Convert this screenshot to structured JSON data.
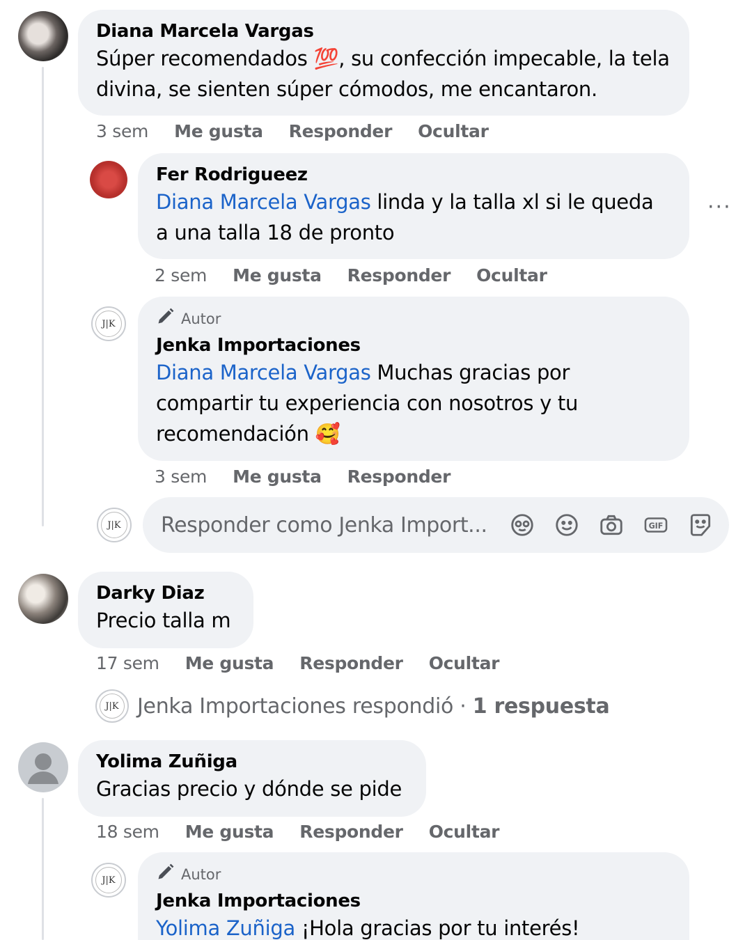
{
  "comments": [
    {
      "author": "Diana Marcela Vargas",
      "text_before": "Súper recomendados ",
      "emoji": "💯",
      "text_after": ", su confección impecable, la tela divina, se sienten súper cómodos, me encantaron.",
      "time": "3 sem",
      "like": "Me gusta",
      "reply": "Responder",
      "hide": "Ocultar"
    },
    {
      "author": "Fer Rodrigueez",
      "mention": "Diana Marcela Vargas",
      "text": " linda y la talla xl si le queda a una talla 18 de pronto",
      "time": "2 sem",
      "like": "Me gusta",
      "reply": "Responder",
      "hide": "Ocultar",
      "more": "···"
    },
    {
      "badge": "Autor",
      "author": "Jenka Importaciones",
      "mention": "Diana Marcela Vargas",
      "text": " Muchas gracias por compartir tu experiencia con nosotros y tu recomendación ",
      "emoji": "🥰",
      "time": "3 sem",
      "like": "Me gusta",
      "reply": "Responder"
    },
    {
      "author": "Darky Diaz",
      "text": "Precio talla m",
      "time": "17 sem",
      "like": "Me gusta",
      "reply": "Responder",
      "hide": "Ocultar"
    },
    {
      "author": "Yolima Zuñiga",
      "text": "Gracias precio y dónde se pide",
      "time": "18 sem",
      "like": "Me gusta",
      "reply": "Responder",
      "hide": "Ocultar"
    },
    {
      "badge": "Autor",
      "author": "Jenka Importaciones",
      "mention": "Yolima Zuñiga",
      "text": " ¡Hola gracias por tu interés!"
    }
  ],
  "reply_box": {
    "placeholder": "Responder como Jenka Import...",
    "icons": [
      "avatar-sticker-icon",
      "emoji-icon",
      "camera-icon",
      "gif-icon",
      "sticker-icon"
    ]
  },
  "replied_summary": {
    "text": "Jenka Importaciones respondió · ",
    "count": "1 respuesta"
  },
  "page_avatar_initials": "J|K",
  "colors": {
    "bubble": "#f0f2f5",
    "mention": "#1b63c9",
    "meta": "#65676b",
    "fer_avatar": "#c0302e"
  }
}
